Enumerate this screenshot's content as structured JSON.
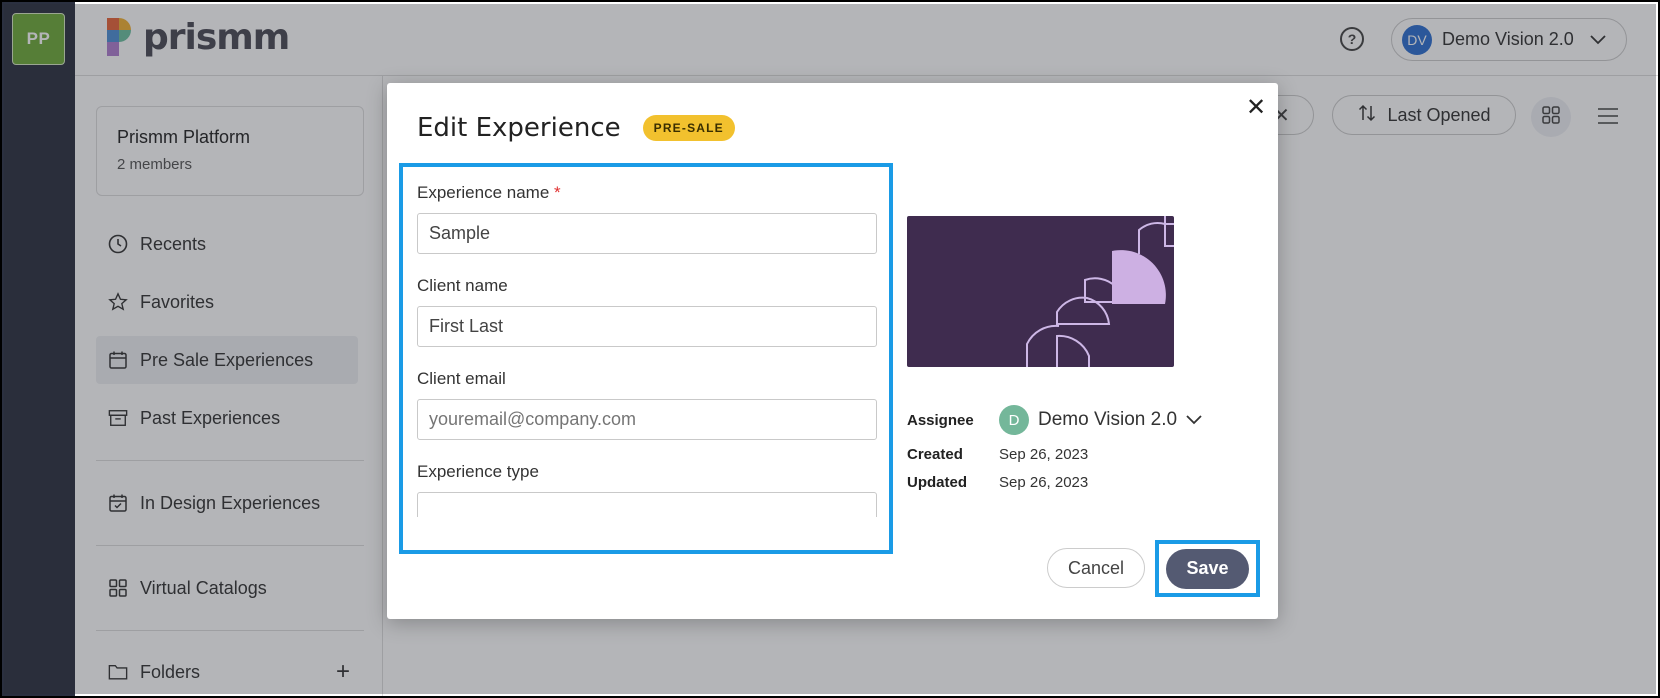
{
  "workspace": {
    "initials": "PP"
  },
  "header": {
    "logo_text": "prismm",
    "user_initials": "DV",
    "user_name": "Demo Vision 2.0"
  },
  "sidebar": {
    "org_name": "Prismm Platform",
    "org_members": "2 members",
    "items": [
      {
        "label": "Recents",
        "icon": "clock-icon"
      },
      {
        "label": "Favorites",
        "icon": "star-icon"
      },
      {
        "label": "Pre Sale Experiences",
        "icon": "calendar-icon",
        "active": true
      },
      {
        "label": "Past Experiences",
        "icon": "archive-icon"
      },
      {
        "label": "In Design Experiences",
        "icon": "calendar-check-icon"
      },
      {
        "label": "Virtual Catalogs",
        "icon": "grid-icon"
      },
      {
        "label": "Folders",
        "icon": "folder-icon"
      }
    ]
  },
  "toolbar": {
    "filter_close": "✕",
    "sort_label": "Last Opened"
  },
  "modal": {
    "title": "Edit Experience",
    "badge": "PRE-SALE",
    "close": "✕",
    "fields": {
      "experience_name": {
        "label": "Experience name",
        "required": "*",
        "value": "Sample"
      },
      "client_name": {
        "label": "Client name",
        "value": "First Last"
      },
      "client_email": {
        "label": "Client email",
        "placeholder": "youremail@company.com"
      },
      "experience_type": {
        "label": "Experience type"
      }
    },
    "meta": {
      "assignee_label": "Assignee",
      "assignee_initial": "D",
      "assignee_name": "Demo Vision 2.0",
      "created_label": "Created",
      "created_value": "Sep 26, 2023",
      "updated_label": "Updated",
      "updated_value": "Sep 26, 2023"
    },
    "cancel_label": "Cancel",
    "save_label": "Save"
  },
  "colors": {
    "accent_highlight": "#1a9be6",
    "badge_yellow": "#f2c12e",
    "save_button": "#545a72",
    "thumbnail_bg": "#3f2c4f"
  }
}
